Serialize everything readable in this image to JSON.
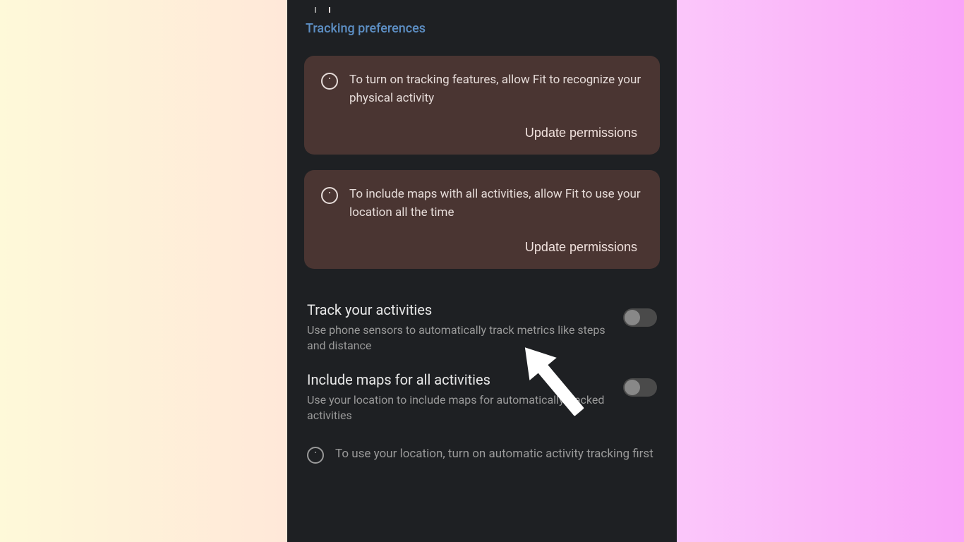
{
  "section": {
    "title": "Tracking preferences"
  },
  "cards": [
    {
      "text": "To turn on tracking features, allow Fit to recognize your physical activity",
      "action": "Update permissions"
    },
    {
      "text": "To include maps with all activities, allow Fit to use your location all the time",
      "action": "Update permissions"
    }
  ],
  "settings": [
    {
      "title": "Track your activities",
      "desc": "Use phone sensors to automatically track metrics like steps and distance",
      "enabled": false
    },
    {
      "title": "Include maps for all activities",
      "desc": "Use your location to include maps for automatically tracked activities",
      "enabled": false
    }
  ],
  "bottom_info": {
    "text": "To use your location, turn on automatic activity tracking first"
  }
}
